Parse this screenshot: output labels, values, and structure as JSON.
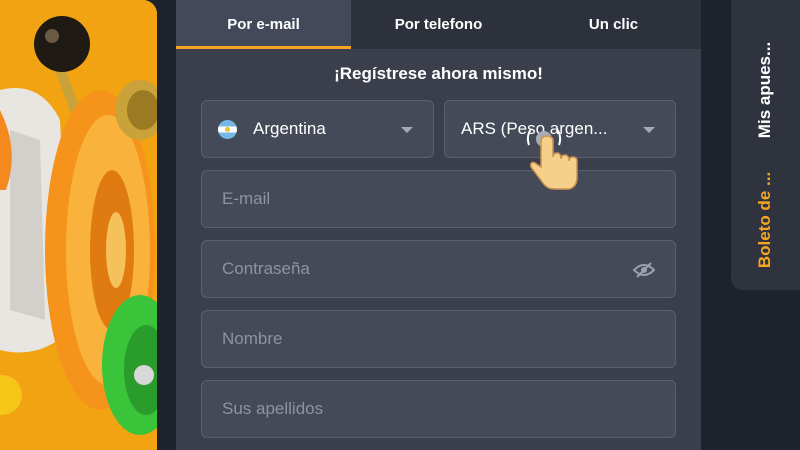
{
  "tabs": [
    {
      "label": "Por e-mail",
      "active": true
    },
    {
      "label": "Por telefono",
      "active": false
    },
    {
      "label": "Un clic",
      "active": false
    }
  ],
  "form": {
    "heading": "¡Regístrese ahora mismo!",
    "country": {
      "value": "Argentina",
      "flag_icon": "argentina-flag-icon"
    },
    "currency": {
      "value": "ARS (Peso argen..."
    },
    "email": {
      "placeholder": "E-mail"
    },
    "password": {
      "placeholder": "Contraseña"
    },
    "first_name": {
      "placeholder": "Nombre"
    },
    "last_name": {
      "placeholder": "Sus apellidos"
    }
  },
  "rail": {
    "my_bets_label": "Mis apues...",
    "bet_slip_label": "Boleto de ..."
  },
  "colors": {
    "accent": "#f5a524",
    "panel": "#3a3f4b",
    "field": "#444a58",
    "background": "#1e222b"
  }
}
